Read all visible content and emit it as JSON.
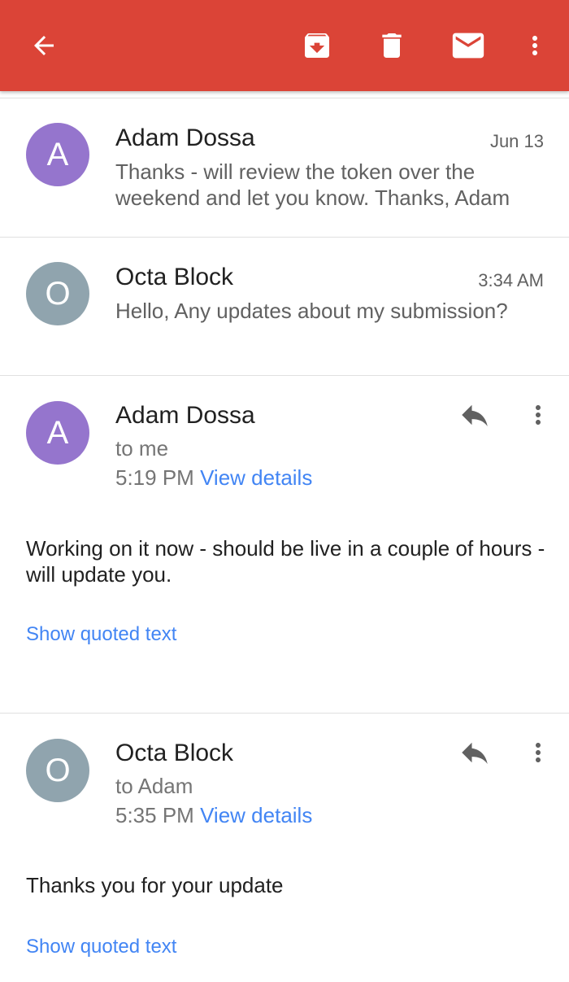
{
  "toolbar": {
    "back_icon": "arrow-back-icon",
    "archive_icon": "archive-icon",
    "delete_icon": "trash-icon",
    "mark_unread_icon": "mail-icon",
    "overflow_icon": "more-vert-icon",
    "bar_color": "#db4437"
  },
  "collapsed_messages": [
    {
      "avatar_letter": "A",
      "avatar_color": "#9575cd",
      "sender": "Adam Dossa",
      "time": "Jun 13",
      "snippet": "Thanks - will review the token over the weekend and let you know. Thanks, Adam"
    },
    {
      "avatar_letter": "O",
      "avatar_color": "#90a4ae",
      "sender": "Octa Block",
      "time": "3:34 AM",
      "snippet": "Hello, Any updates about my submission?"
    }
  ],
  "expanded_messages": [
    {
      "avatar_letter": "A",
      "avatar_color": "#9575cd",
      "sender": "Adam Dossa",
      "recipient": "to me",
      "time": "5:19 PM",
      "details_label": "View details",
      "body": "Working on it now - should be live in a couple of hours - will update you.",
      "quoted_label": "Show quoted text"
    },
    {
      "avatar_letter": "O",
      "avatar_color": "#90a4ae",
      "sender": "Octa Block",
      "recipient": "to Adam",
      "time": "5:35 PM",
      "details_label": "View details",
      "body": "Thanks you for your update",
      "quoted_label": "Show quoted text"
    }
  ]
}
